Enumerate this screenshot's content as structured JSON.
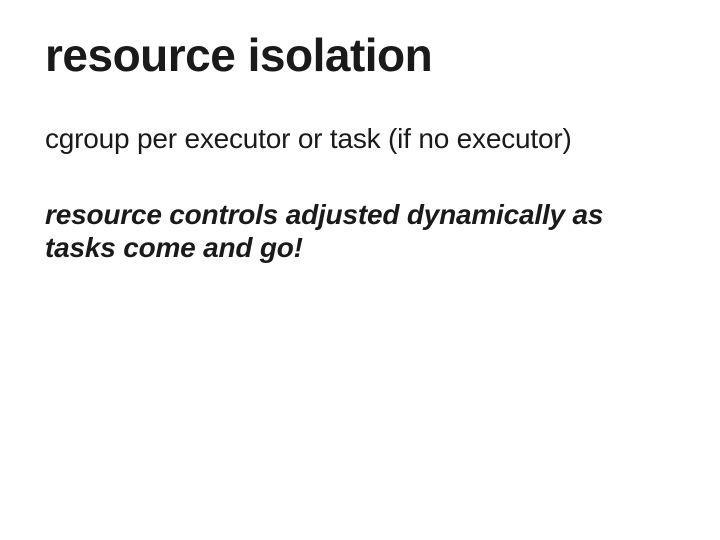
{
  "slide": {
    "title": "resource isolation",
    "line1": "cgroup per executor or task (if no executor)",
    "line2": "resource controls adjusted dynamically as tasks come and go!"
  }
}
